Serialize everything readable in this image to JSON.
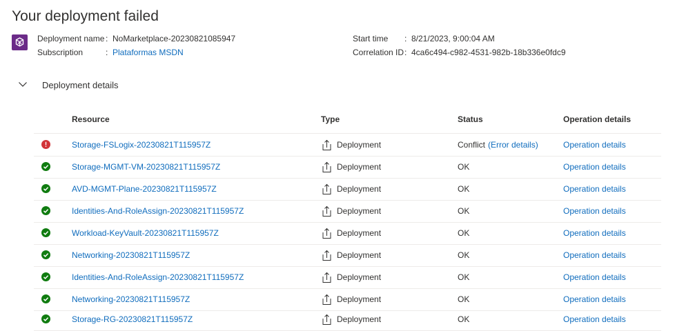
{
  "page": {
    "title": "Your deployment failed"
  },
  "meta": {
    "deployment_name_label": "Deployment name",
    "deployment_name_value": "NoMarketplace-20230821085947",
    "subscription_label": "Subscription",
    "subscription_value": "Plataformas MSDN",
    "start_time_label": "Start time",
    "start_time_value": "8/21/2023, 9:00:04 AM",
    "correlation_label": "Correlation ID",
    "correlation_value": "4ca6c494-c982-4531-982b-18b336e0fdc9",
    "separator": ":"
  },
  "section": {
    "title": "Deployment details",
    "toggle_icon": "chevron-down-icon"
  },
  "table": {
    "headers": {
      "resource": "Resource",
      "type": "Type",
      "status": "Status",
      "operation": "Operation details"
    },
    "rows": [
      {
        "status_icon": "error-icon",
        "resource": "Storage-FSLogix-20230821T115957Z",
        "type": "Deployment",
        "status": "Conflict",
        "error_link": "(Error details)",
        "operation": "Operation details"
      },
      {
        "status_icon": "success-icon",
        "resource": "Storage-MGMT-VM-20230821T115957Z",
        "type": "Deployment",
        "status": "OK",
        "operation": "Operation details"
      },
      {
        "status_icon": "success-icon",
        "resource": "AVD-MGMT-Plane-20230821T115957Z",
        "type": "Deployment",
        "status": "OK",
        "operation": "Operation details"
      },
      {
        "status_icon": "success-icon",
        "resource": "Identities-And-RoleAssign-20230821T115957Z",
        "type": "Deployment",
        "status": "OK",
        "operation": "Operation details"
      },
      {
        "status_icon": "success-icon",
        "resource": "Workload-KeyVault-20230821T115957Z",
        "type": "Deployment",
        "status": "OK",
        "operation": "Operation details"
      },
      {
        "status_icon": "success-icon",
        "resource": "Networking-20230821T115957Z",
        "type": "Deployment",
        "status": "OK",
        "operation": "Operation details"
      },
      {
        "status_icon": "success-icon",
        "resource": "Identities-And-RoleAssign-20230821T115957Z",
        "type": "Deployment",
        "status": "OK",
        "operation": "Operation details"
      },
      {
        "status_icon": "success-icon",
        "resource": "Networking-20230821T115957Z",
        "type": "Deployment",
        "status": "OK",
        "operation": "Operation details"
      },
      {
        "status_icon": "success-icon",
        "resource": "Storage-RG-20230821T115957Z",
        "type": "Deployment",
        "status": "OK",
        "operation": "Operation details"
      }
    ]
  },
  "colors": {
    "link": "#0f6cbd",
    "success": "#107c10",
    "error": "#d13438",
    "deployment_icon_bg": "#6b2b88"
  }
}
